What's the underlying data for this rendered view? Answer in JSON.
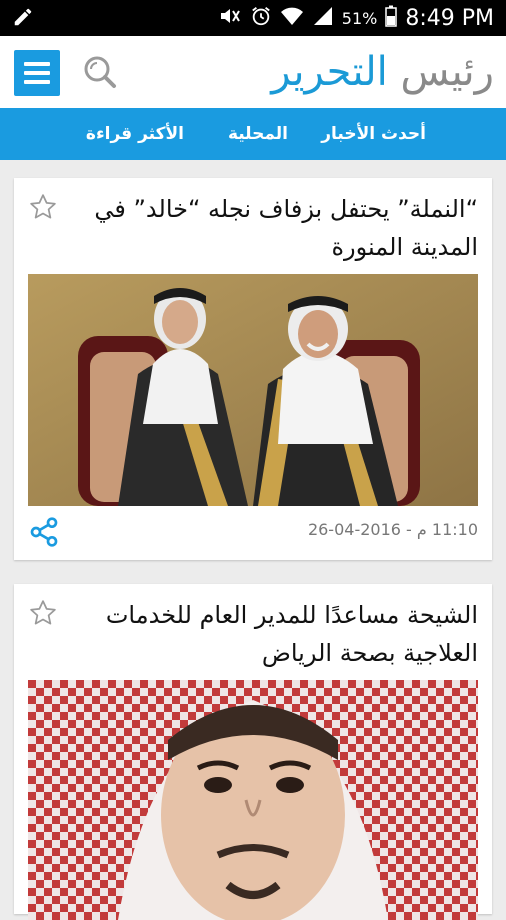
{
  "status_bar": {
    "battery_percent": "51%",
    "time": "8:49 PM"
  },
  "app": {
    "logo_part1": "رئيس",
    "logo_part2": "التحرير"
  },
  "tabs": [
    {
      "label": "أحدث الأخبار"
    },
    {
      "label": "المحلية"
    },
    {
      "label": "الأكثر قراءة"
    }
  ],
  "articles": [
    {
      "title": "“النملة” يحتفل بزفاف نجله “خالد” في المدينة المنورة",
      "time": "11:10 م",
      "date": "2016-04-26"
    },
    {
      "title": "الشيحة مساعدًا للمدير العام للخدمات العلاجية بصحة الرياض"
    }
  ],
  "colors": {
    "accent": "#1a9be0",
    "logo_gray": "#8a8a8a"
  }
}
